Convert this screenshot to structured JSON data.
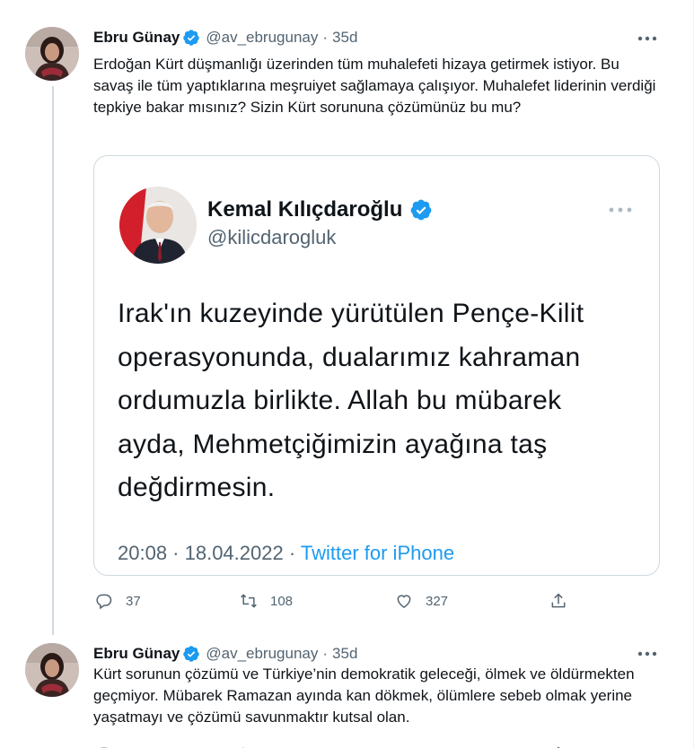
{
  "tweets": [
    {
      "author_name": "Ebru Günay",
      "handle": "@av_ebrugunay",
      "separator": "·",
      "age": "35d",
      "text": "Erdoğan Kürt düşmanlığı üzerinden tüm muhalefeti hizaya getirmek istiyor. Bu savaş ile tüm yaptıklarına meşruiyet sağlamaya çalışıyor. Muhalefet liderinin verdiği tepkiye bakar mısınız? Sizin Kürt sorununa çözümünüz bu mu?",
      "quote": {
        "author_name": "Kemal Kılıçdaroğlu",
        "handle": "@kilicdarogluk",
        "text": "Irak'ın kuzeyinde yürütülen Pençe-Kilit operasyonunda, dualarımız kahraman ordumuzla birlikte. Allah bu mübarek ayda, Mehmetçiğimizin ayağına taş değdirmesin.",
        "timestamp": "20:08 · 18.04.2022 · ",
        "source": "Twitter for iPhone"
      },
      "replies": "37",
      "retweets": "108",
      "likes": "327"
    },
    {
      "author_name": "Ebru Günay",
      "handle": "@av_ebrugunay",
      "separator": "·",
      "age": "35d",
      "text": "Kürt sorunun çözümü ve Türkiye’nin demokratik geleceği, ölmek ve öldürmekten geçmiyor. Mübarek Ramazan ayında kan dökmek, ölümlere sebeb olmak yerine yaşatmayı ve çözümü savunmaktır kutsal olan."
    }
  ],
  "icons": {
    "verified": "verified-badge-icon",
    "more": "more-horizontal-icon",
    "reply": "reply-icon",
    "retweet": "retweet-icon",
    "like": "heart-icon",
    "share": "share-icon"
  },
  "colors": {
    "accent": "#1d9bf0",
    "text": "#0f1419",
    "secondary": "#536471",
    "border": "#cfd9de"
  }
}
